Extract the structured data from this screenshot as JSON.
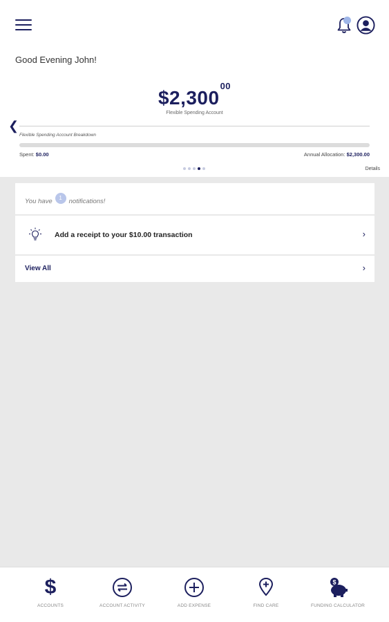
{
  "header": {
    "menu_icon": "hamburger-icon",
    "bell_icon": "bell-icon",
    "profile_icon": "user-circle-icon"
  },
  "greeting": "Good Evening John!",
  "account": {
    "balance_main": "$2,300",
    "balance_cents": "00",
    "label": "Flexible Spending Account",
    "breakdown_label": "Flexible Spending Account Breakdown",
    "spent_label": "Spent:",
    "spent_value": "$0.00",
    "allocation_label": "Annual Allocation:",
    "allocation_value": "$2,300.00",
    "spent_fraction": 0.0,
    "details_label": "Details",
    "page_count": 5,
    "active_page": 4
  },
  "notifications": {
    "prefix": "You have",
    "count": "1",
    "suffix": "notifications!",
    "items": [
      {
        "icon": "lightbulb-icon",
        "text": "Add a receipt to your $10.00 transaction"
      }
    ],
    "view_all_label": "View All"
  },
  "bottom_nav": [
    {
      "icon": "dollar-icon",
      "label": "ACCOUNTS"
    },
    {
      "icon": "exchange-icon",
      "label": "ACCOUNT ACTIVITY"
    },
    {
      "icon": "plus-circle-icon",
      "label": "ADD EXPENSE"
    },
    {
      "icon": "map-pin-plus-icon",
      "label": "FIND CARE"
    },
    {
      "icon": "piggy-bank-icon",
      "label": "FUNDING CALCULATOR"
    }
  ],
  "colors": {
    "primary": "#1c1f5e",
    "accent": "#9fb6e8",
    "background": "#e9e9e9"
  }
}
